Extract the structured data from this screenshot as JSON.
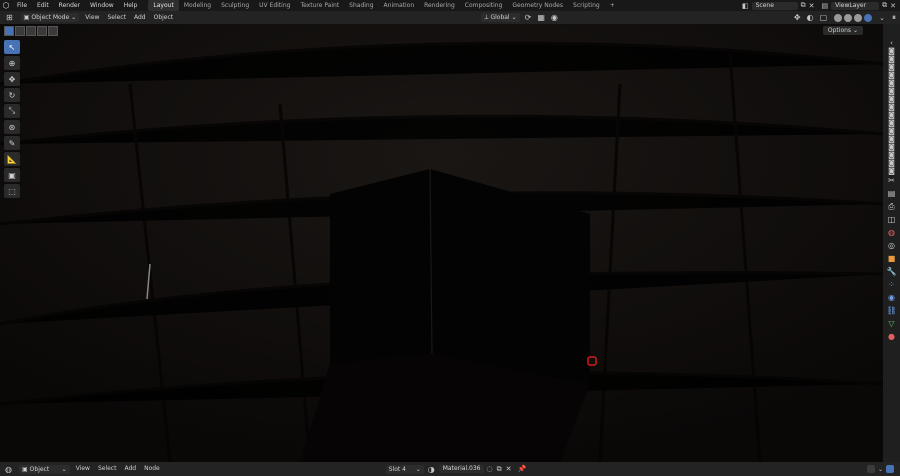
{
  "topbar": {
    "menu": [
      "File",
      "Edit",
      "Render",
      "Window",
      "Help"
    ],
    "workspaces": [
      "Layout",
      "Modeling",
      "Sculpting",
      "UV Editing",
      "Texture Paint",
      "Shading",
      "Animation",
      "Rendering",
      "Compositing",
      "Geometry Nodes",
      "Scripting"
    ],
    "active_workspace": "Layout",
    "add_tab": "+",
    "scene": "Scene",
    "view_layer": "ViewLayer"
  },
  "viewport_header": {
    "mode": "Object Mode",
    "menus": [
      "View",
      "Select",
      "Add",
      "Object"
    ],
    "orientation": "Global"
  },
  "options_label": "Options",
  "bottom_bar": {
    "mode": "Object",
    "menus": [
      "View",
      "Select",
      "Add",
      "Node"
    ],
    "slot": "Slot 4",
    "material": "Material.036"
  },
  "colors": {
    "accent": "#4772b3",
    "viewport_bg": "#0c0908",
    "marker": "#d41a1a"
  }
}
